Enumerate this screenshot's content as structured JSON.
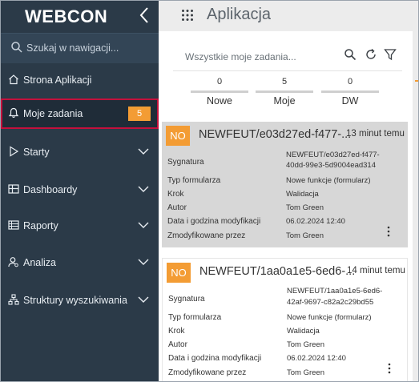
{
  "sidebar": {
    "logo": "WEBCON",
    "collapse_icon": "chevron-left-icon",
    "search_placeholder": "Szukaj w nawigacji...",
    "items": [
      {
        "label": "Strona Aplikacji",
        "icon": "home-icon"
      },
      {
        "label": "Moje zadania",
        "icon": "bell-icon",
        "badge": "5",
        "active": true
      },
      {
        "label": "Starty",
        "icon": "play-icon",
        "expandable": true
      },
      {
        "label": "Dashboardy",
        "icon": "dashboard-icon",
        "expandable": true
      },
      {
        "label": "Raporty",
        "icon": "report-icon",
        "expandable": true
      },
      {
        "label": "Analiza",
        "icon": "user-analysis-icon",
        "expandable": true
      },
      {
        "label": "Struktury wyszukiwania",
        "icon": "hierarchy-icon",
        "expandable": true
      }
    ]
  },
  "header": {
    "title": "Aplikacja",
    "icon": "app-grid-icon"
  },
  "tasks": {
    "filter_label": "Wszystkie moje zadania...",
    "counters": [
      {
        "count": "0",
        "label": "Nowe"
      },
      {
        "count": "5",
        "label": "Moje"
      },
      {
        "count": "0",
        "label": "DW"
      }
    ],
    "field_labels": {
      "signature": "Sygnatura",
      "form_type": "Typ formularza",
      "step": "Krok",
      "author": "Autor",
      "modified_date": "Data i godzina modyfikacji",
      "modified_by": "Zmodyfikowane przez"
    },
    "cards": [
      {
        "tag": "NO",
        "title": "NEWFEUT/e03d27ed-f477-...",
        "time": "13 minut temu",
        "signature_1": "NEWFEUT/e03d27ed-f477-",
        "signature_2": "40dd-99e3-5d9004ead314",
        "form_type": "Nowe funkcje (formularz)",
        "step": "Walidacja",
        "author": "Tom Green",
        "modified_date": "06.02.2024 12:40",
        "modified_by": "Tom Green",
        "selected": true
      },
      {
        "tag": "NO",
        "title": "NEWFEUT/1aa0a1e5-6ed6-...",
        "time": "14 minut temu",
        "signature_1": "NEWFEUT/1aa0a1e5-6ed6-",
        "signature_2": "42af-9697-c82a2c29bd55",
        "form_type": "Nowe funkcje (formularz)",
        "step": "Walidacja",
        "author": "Tom Green",
        "modified_date": "06.02.2024 12:40",
        "modified_by": "Tom Green",
        "selected": false
      }
    ]
  },
  "colors": {
    "sidebar_bg": "#2b3a48",
    "accent_orange": "#f39c34",
    "active_border": "#c4103c",
    "selected_card": "#d7d7d7"
  }
}
